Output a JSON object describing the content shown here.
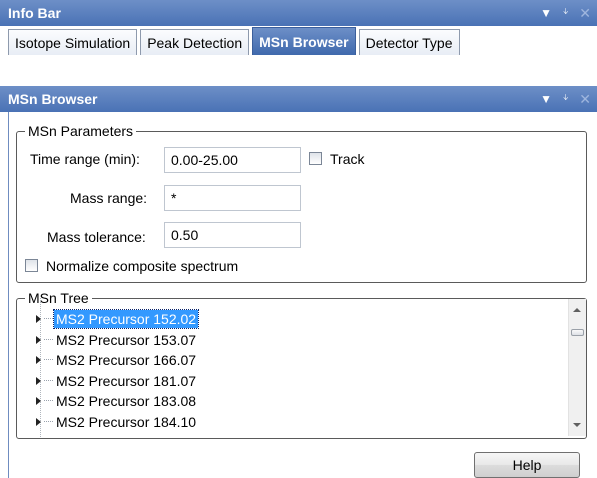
{
  "info_bar": {
    "title": "Info Bar",
    "pin_icon": "pin-icon",
    "close_icon": "close-icon",
    "dropdown_icon": "dropdown-triangle-icon"
  },
  "tabs": [
    {
      "label": "Isotope Simulation",
      "active": false
    },
    {
      "label": "Peak Detection",
      "active": false
    },
    {
      "label": "MSn Browser",
      "active": true
    },
    {
      "label": "Detector Type",
      "active": false
    }
  ],
  "msn_panel": {
    "title": "MSn Browser"
  },
  "params": {
    "legend": "MSn Parameters",
    "time_range_label": "Time range (min):",
    "time_range_value": "0.00-25.00",
    "track_label": "Track",
    "track_checked": false,
    "mass_range_label": "Mass range:",
    "mass_range_value": "*",
    "mass_tolerance_label": "Mass tolerance:",
    "mass_tolerance_value": "0.50",
    "normalize_label": "Normalize composite spectrum",
    "normalize_checked": false
  },
  "tree": {
    "legend": "MSn Tree",
    "items": [
      "MS2 Precursor 152.02",
      "MS2 Precursor 153.07",
      "MS2 Precursor 166.07",
      "MS2 Precursor 181.07",
      "MS2 Precursor 183.08",
      "MS2 Precursor 184.10"
    ],
    "selected_index": 0
  },
  "help_button": {
    "label": "Help"
  },
  "colors": {
    "title_bar": "#4a72b5",
    "active_tab": "#3f69ad",
    "selection": "#3399ff"
  }
}
